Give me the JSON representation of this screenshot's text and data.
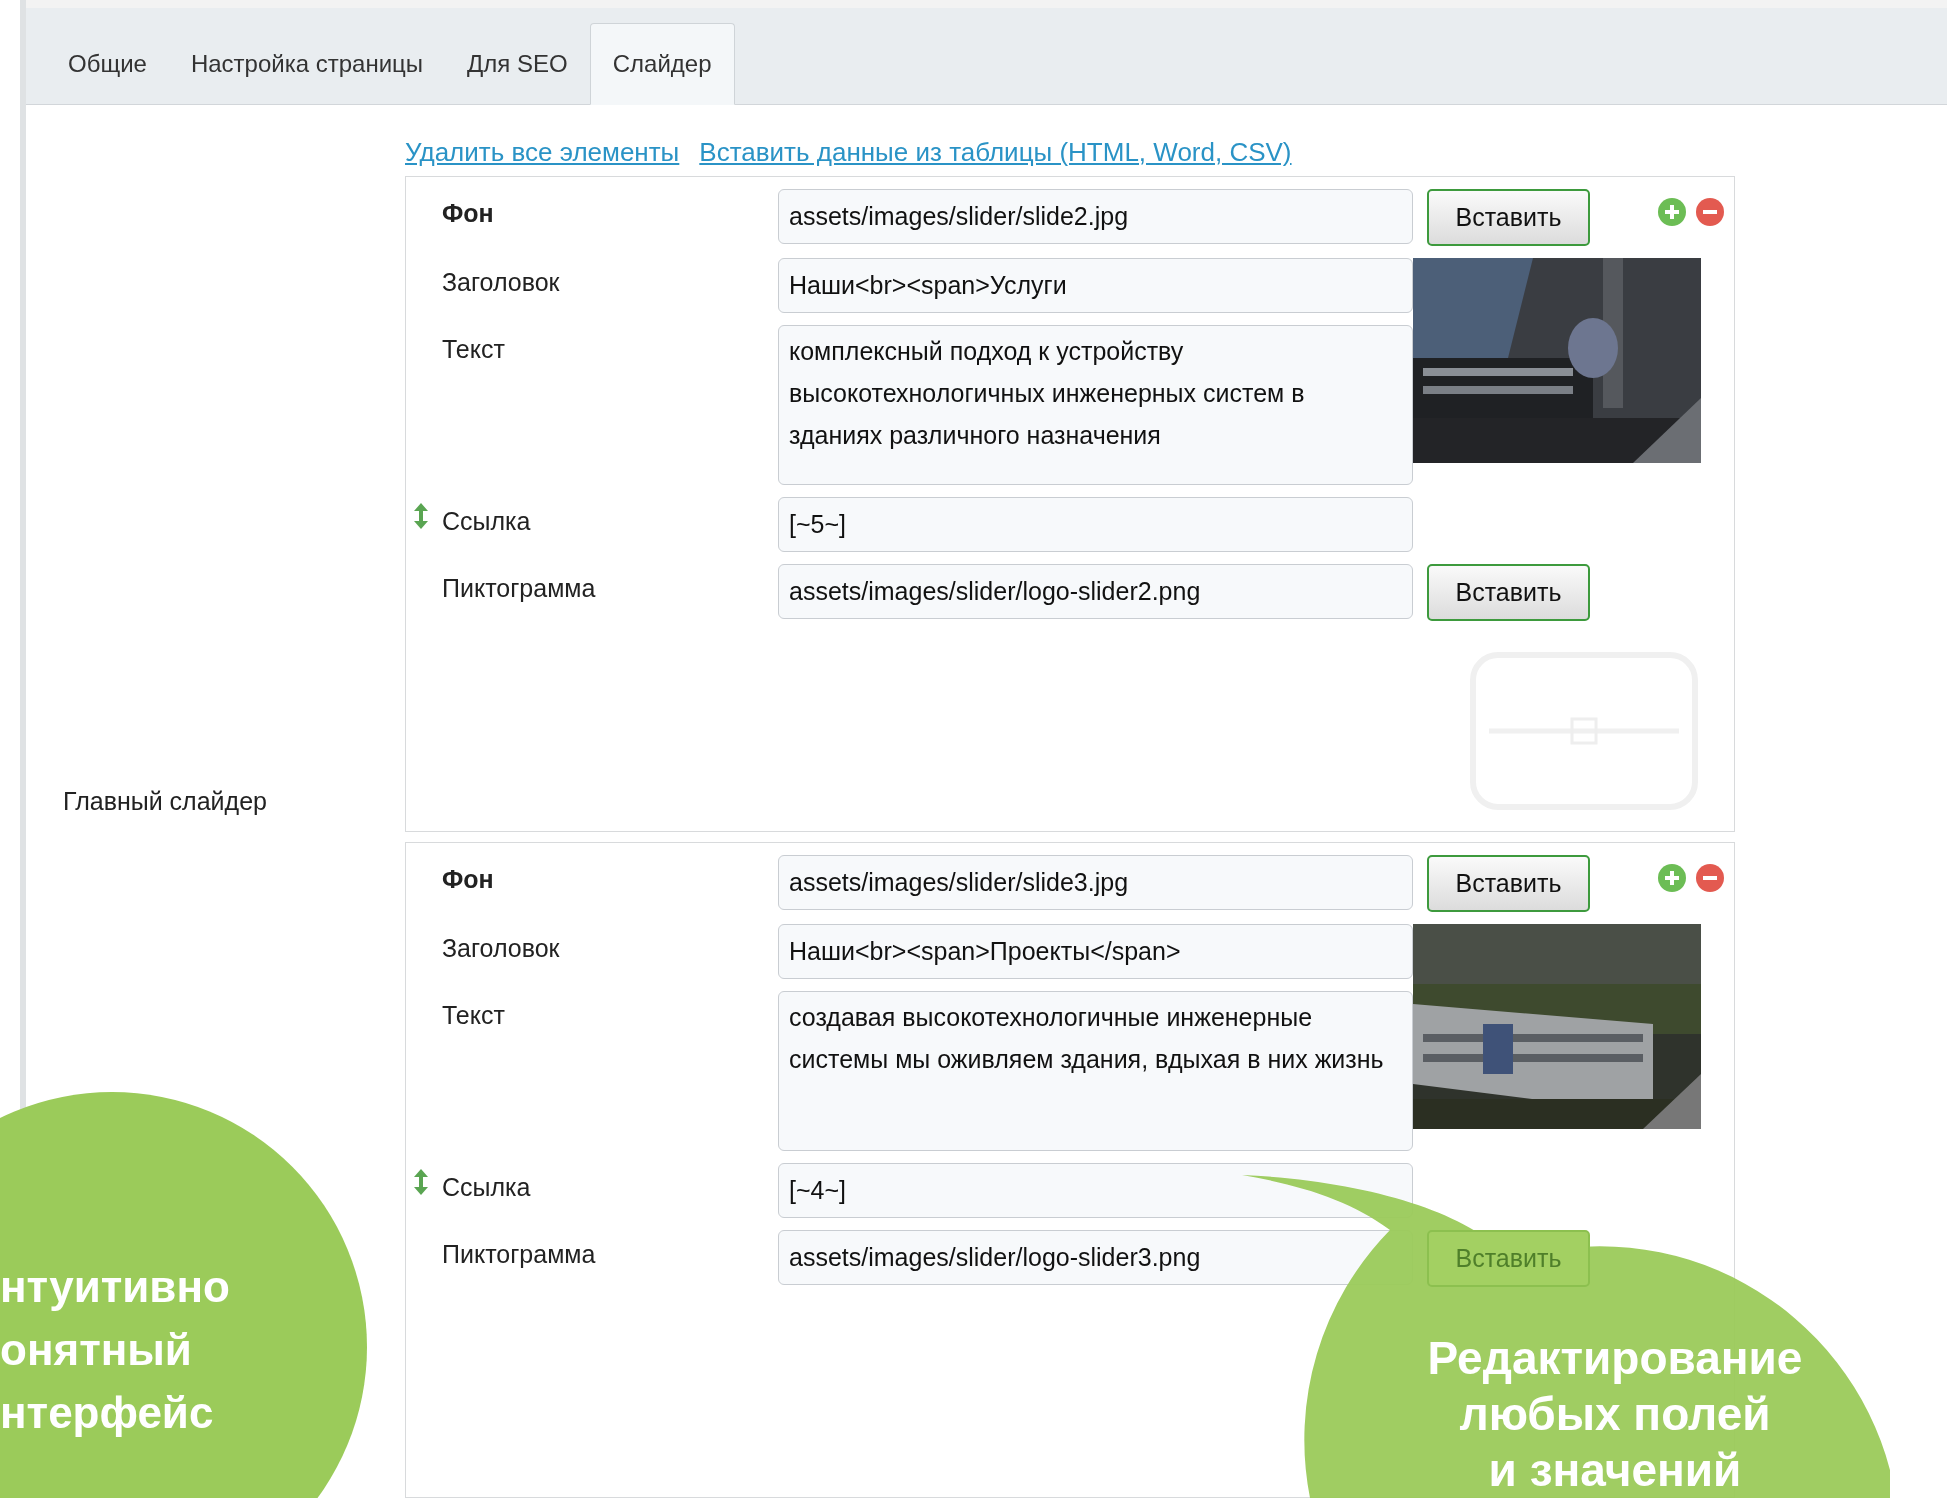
{
  "tabs": [
    {
      "label": "Общие",
      "selected": false
    },
    {
      "label": "Настройка страницы",
      "selected": false
    },
    {
      "label": "Для SEO",
      "selected": false
    },
    {
      "label": "Слайдер",
      "selected": true
    }
  ],
  "field_label": "Главный слайдер",
  "actions": [
    "Удалить все элементы",
    "Вставить данные из таблицы (HTML, Word, CSV)"
  ],
  "slides": [
    {
      "fields": [
        {
          "label": "Фон",
          "kind": "input",
          "bold": true,
          "value": "assets/images/slider/slide2.jpg",
          "button": "Вставить",
          "sortable": false
        },
        {
          "label": "Заголовок",
          "kind": "input",
          "bold": false,
          "value": "Наши<br><span>Услуги",
          "sortable": false
        },
        {
          "label": "Текст",
          "kind": "textarea",
          "bold": false,
          "value": "комплексный подход к устройству высокотехнологичных инженерных систем в зданиях различного назначения",
          "sortable": false
        },
        {
          "label": "Ссылка",
          "kind": "input",
          "bold": false,
          "value": "[~5~]",
          "sortable": true
        },
        {
          "label": "Пиктограмма",
          "kind": "input",
          "bold": false,
          "value": "assets/images/slider/logo-slider2.png",
          "button": "Вставить",
          "sortable": false
        }
      ],
      "logo_preview": true
    },
    {
      "fields": [
        {
          "label": "Фон",
          "kind": "input",
          "bold": true,
          "value": "assets/images/slider/slide3.jpg",
          "button": "Вставить",
          "sortable": false
        },
        {
          "label": "Заголовок",
          "kind": "input",
          "bold": false,
          "value": "Наши<br><span>Проекты</span>",
          "sortable": false
        },
        {
          "label": "Текст",
          "kind": "textarea",
          "bold": false,
          "value": "создавая высокотехнологичные инженерные системы мы оживляем здания, вдыхая в них жизнь",
          "sortable": false
        },
        {
          "label": "Ссылка",
          "kind": "input",
          "bold": false,
          "value": "[~4~]",
          "sortable": true
        },
        {
          "label": "Пиктограмма",
          "kind": "input",
          "bold": false,
          "value": "assets/images/slider/logo-slider3.png",
          "button": "Вставить",
          "sortable": false
        }
      ],
      "logo_preview": false
    }
  ],
  "callouts": [
    {
      "lines": [
        "нтуитивно",
        "онятный",
        "нтерфейс"
      ]
    },
    {
      "lines": [
        "Редактирование",
        "любых полей",
        "и значений"
      ]
    }
  ]
}
